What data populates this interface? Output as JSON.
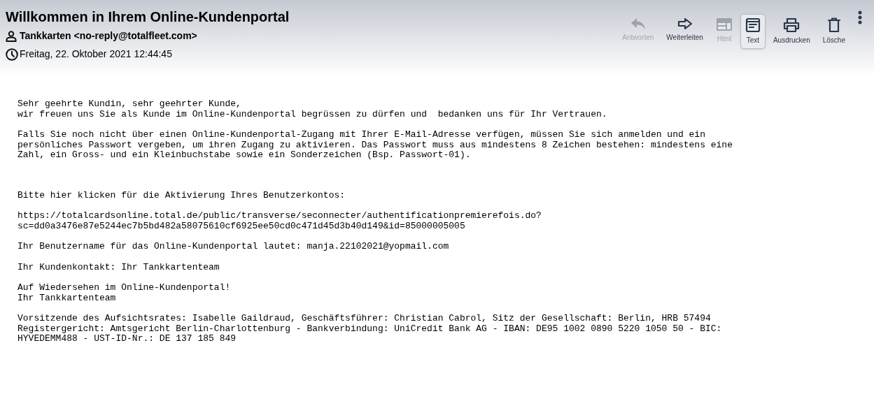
{
  "header": {
    "subject": "Willkommen in Ihrem Online-Kundenportal",
    "sender": "Tankkarten <no-reply@totalfleet.com>",
    "date": "Freitag, 22. Oktober 2021 12:44:45"
  },
  "toolbar": [
    {
      "kind": "reply",
      "label": "Antworten",
      "disabled": true,
      "selected": false
    },
    {
      "kind": "forward",
      "label": "Weiterleiten",
      "disabled": false,
      "selected": false
    },
    {
      "kind": "html",
      "label": "Html",
      "disabled": true,
      "selected": false
    },
    {
      "kind": "text",
      "label": "Text",
      "disabled": false,
      "selected": true
    },
    {
      "kind": "print",
      "label": "Ausdrucken",
      "disabled": false,
      "selected": false
    },
    {
      "kind": "delete",
      "label": "Lösche",
      "disabled": false,
      "selected": false
    },
    {
      "kind": "more",
      "disabled": false,
      "selected": false
    }
  ],
  "body": [
    "Sehr geehrte Kundin, sehr geehrter Kunde,\nwir freuen uns Sie als Kunde im Online-Kundenportal begrüssen zu dürfen und  bedanken uns für Ihr Vertrauen.",
    "Falls Sie noch nicht über einen Online-Kundenportal-Zugang mit Ihrer E-Mail-Adresse verfügen, müssen Sie sich anmelden und ein\npersönliches Passwort vergeben, um ihren Zugang zu aktivieren. Das Passwort muss aus mindestens 8 Zeichen bestehen: mindestens eine\nZahl, ein Gross- und ein Kleinbuchstabe sowie ein Sonderzeichen (Bsp. Passwort-01).",
    "Bitte hier klicken für die Aktivierung Ihres Benutzerkontos:",
    "https://totalcardsonline.total.de/public/transverse/seconnecter/authentificationpremierefois.do?\nsc=dd0a3476e87e5244ec7b5bd482a58075610cf6925ee50cd0c471d45d3b40d149&id=85000005005",
    "Ihr Benutzername für das Online-Kundenportal lautet: manja.22102021@yopmail.com",
    "Ihr Kundenkontakt: Ihr Tankkartenteam",
    "Auf Wiedersehen im Online-Kundenportal!\nIhr Tankkartenteam",
    "Vorsitzende des Aufsichtsrates: Isabelle Gaildraud, Geschäftsführer: Christian Cabrol, Sitz der Gesellschaft: Berlin, HRB 57494\nRegistergericht: Amtsgericht Berlin-Charlottenburg - Bankverbindung: UniCredit Bank AG - IBAN: DE95 1002 0890 5220 1050 50 - BIC:\nHYVEDEMM488 - UST-ID-Nr.: DE 137 185 849"
  ]
}
